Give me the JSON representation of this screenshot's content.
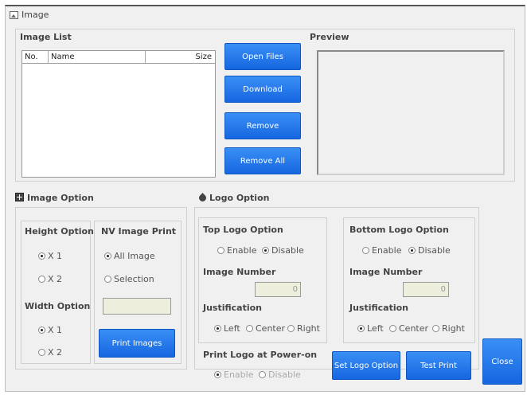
{
  "window": {
    "title": "Image"
  },
  "image_list": {
    "label": "Image List",
    "columns": [
      "No.",
      "Name",
      "Size"
    ],
    "rows": []
  },
  "buttons": {
    "open_files": "Open Files",
    "download": "Download",
    "remove": "Remove",
    "remove_all": "Remove All",
    "print_images": "Print Images",
    "set_logo_option": "Set Logo Option",
    "test_print": "Test Print",
    "close": "Close"
  },
  "preview": {
    "label": "Preview"
  },
  "image_option": {
    "label": "Image Option",
    "height_option": {
      "label": "Height Option",
      "options": [
        "X 1",
        "X 2"
      ],
      "selected": "X 1"
    },
    "width_option": {
      "label": "Width Option",
      "options": [
        "X 1",
        "X 2"
      ],
      "selected": "X 1"
    },
    "nv_image_print": {
      "label": "NV Image Print",
      "options": [
        "All Image",
        "Selection"
      ],
      "selected": "All Image",
      "selection_value": ""
    }
  },
  "logo_option": {
    "label": "Logo Option",
    "top": {
      "label": "Top Logo Option",
      "enable": "Enable",
      "disable": "Disable",
      "selected": "Disable",
      "image_number_label": "Image Number",
      "image_number": "0",
      "justification_label": "Justification",
      "justification": [
        "Left",
        "Center",
        "Right"
      ],
      "justification_selected": "Left"
    },
    "bottom": {
      "label": "Bottom Logo Option",
      "enable": "Enable",
      "disable": "Disable",
      "selected": "Disable",
      "image_number_label": "Image Number",
      "image_number": "0",
      "justification_label": "Justification",
      "justification": [
        "Left",
        "Center",
        "Right"
      ],
      "justification_selected": "Left"
    },
    "power_on": {
      "label": "Print Logo at Power-on",
      "enable": "Enable",
      "disable": "Disable",
      "selected": "Enable"
    }
  },
  "colors": {
    "button_blue": "#1f73e8",
    "background": "#f0f0f0"
  }
}
